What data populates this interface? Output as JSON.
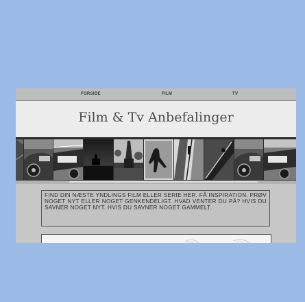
{
  "nav": {
    "links": [
      "FORSIDE",
      "FILM",
      "TV"
    ]
  },
  "header": {
    "title": "Film & Tv Anbefalinger"
  },
  "intro": {
    "text": "FIND DIN NÆSTE YNDLINGS FILM ELLER SERIE HER. FÅ INSPIRATION. PRØV NOGET NYT ELLER NOGET GENKENDELIGT. HVAD VENTER DU PÅ? HVIS DU SAVNER NOGET NYT. HVIS DU SAVNER NOGET GAMMELT."
  },
  "photos": [
    "cropped-edge-photo",
    "vintage-car-photo",
    "vintage-car-closeup-photo",
    "pier-silhouette-photo",
    "church-tower-photo",
    "shadow-figure-photo",
    "escalator-photo",
    "diagonal-shadow-photo",
    "vintage-car-photo-repeat",
    "vintage-car-closeup-photo-repeat"
  ]
}
